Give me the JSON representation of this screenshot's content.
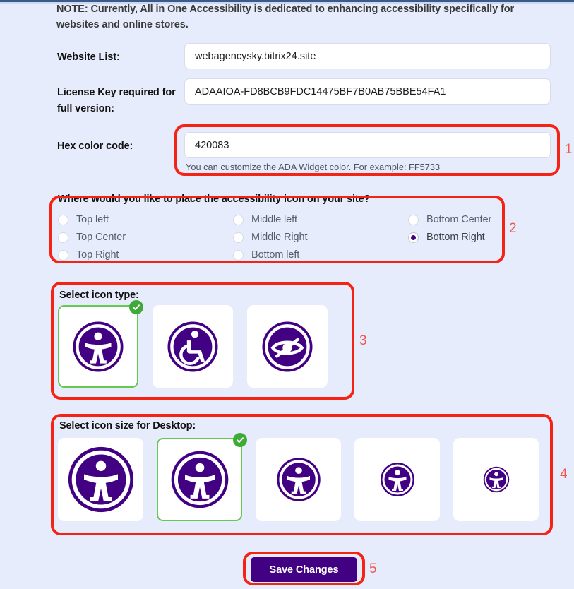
{
  "note": "NOTE: Currently, All in One Accessibility is dedicated to enhancing accessibility specifically for websites and online stores.",
  "colors": {
    "accent_purple": "#420083",
    "annotation_red": "#f42314",
    "selected_green": "#63c950",
    "check_badge_green": "#3fa93a",
    "page_background": "#e7ecfc"
  },
  "fields": {
    "website": {
      "label": "Website List:",
      "value": "webagencysky.bitrix24.site",
      "placeholder": ""
    },
    "license": {
      "label": "License Key required for full version:",
      "value": "ADAAIOA-FD8BCB9FDC14475BF7B0AB75BBE54FA1",
      "placeholder": ""
    },
    "hex": {
      "label": "Hex color code:",
      "value": "420083",
      "placeholder": "",
      "help": "You can customize the ADA Widget color. For example: FF5733"
    }
  },
  "placement": {
    "question": "Where would you like to place the accessibility icon on your site?",
    "columns": [
      [
        {
          "label": "Top left",
          "checked": false
        },
        {
          "label": "Top Center",
          "checked": false
        },
        {
          "label": "Top Right",
          "checked": false
        }
      ],
      [
        {
          "label": "Middle left",
          "checked": false
        },
        {
          "label": "Middle Right",
          "checked": false
        },
        {
          "label": "Bottom left",
          "checked": false
        }
      ],
      [
        {
          "label": "Bottom Center",
          "checked": false
        },
        {
          "label": "Bottom Right",
          "checked": true
        }
      ]
    ]
  },
  "icon_type": {
    "title": "Select icon type:",
    "options": [
      {
        "icon": "accessibility-person-icon",
        "selected": true
      },
      {
        "icon": "wheelchair-icon",
        "selected": false
      },
      {
        "icon": "eye-slash-icon",
        "selected": false
      }
    ]
  },
  "icon_size": {
    "title": "Select icon size for Desktop:",
    "options": [
      {
        "icon": "accessibility-person-icon",
        "size": 96,
        "selected": false
      },
      {
        "icon": "accessibility-person-icon",
        "size": 84,
        "selected": true
      },
      {
        "icon": "accessibility-person-icon",
        "size": 64,
        "selected": false
      },
      {
        "icon": "accessibility-person-icon",
        "size": 50,
        "selected": false
      },
      {
        "icon": "accessibility-person-icon",
        "size": 38,
        "selected": false
      }
    ]
  },
  "save": {
    "label": "Save Changes"
  },
  "annotations": {
    "n1": "1",
    "n2": "2",
    "n3": "3",
    "n4": "4",
    "n5": "5"
  }
}
